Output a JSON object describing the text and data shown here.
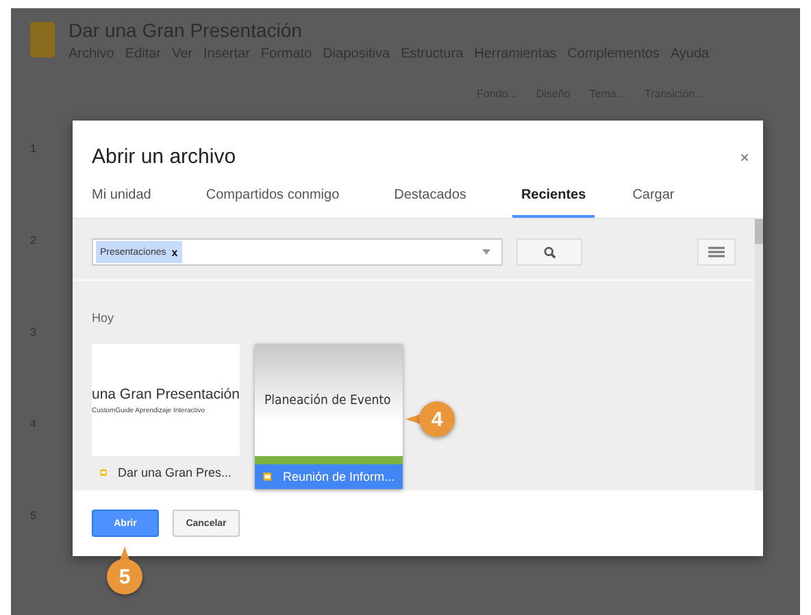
{
  "app": {
    "title": "Dar una Gran Presentación",
    "menu": [
      "Archivo",
      "Editar",
      "Ver",
      "Insertar",
      "Formato",
      "Diapositiva",
      "Estructura",
      "Herramientas",
      "Complementos",
      "Ayuda"
    ],
    "toolbar": [
      "Fondo...",
      "Diseño",
      "Tema...",
      "Transición..."
    ],
    "slide_numbers": [
      "1",
      "2",
      "3",
      "4",
      "5"
    ]
  },
  "dialog": {
    "title": "Abrir un archivo",
    "close": "×",
    "tabs": [
      {
        "label": "Mi unidad",
        "selected": false
      },
      {
        "label": "Compartidos conmigo",
        "selected": false
      },
      {
        "label": "Destacados",
        "selected": false
      },
      {
        "label": "Recientes",
        "selected": true
      },
      {
        "label": "Cargar",
        "selected": false
      }
    ],
    "filter_chip": "Presentaciones",
    "chip_remove": "x",
    "section": "Hoy",
    "files": [
      {
        "name": "Dar una Gran Pres...",
        "preview_title": "una Gran Presentación",
        "preview_subtitle": "CustomGuide Aprendizaje Interactivo",
        "kind": "plain",
        "selected": false
      },
      {
        "name": "Reunión de Inform...",
        "preview_title": "Planeación de Evento",
        "kind": "gradient",
        "selected": true
      }
    ],
    "buttons": [
      {
        "label": "Abrir",
        "primary": true
      },
      {
        "label": "Cancelar",
        "primary": false
      }
    ]
  },
  "callouts": [
    {
      "label": "4",
      "kind": "left"
    },
    {
      "label": "5",
      "kind": "up"
    }
  ]
}
